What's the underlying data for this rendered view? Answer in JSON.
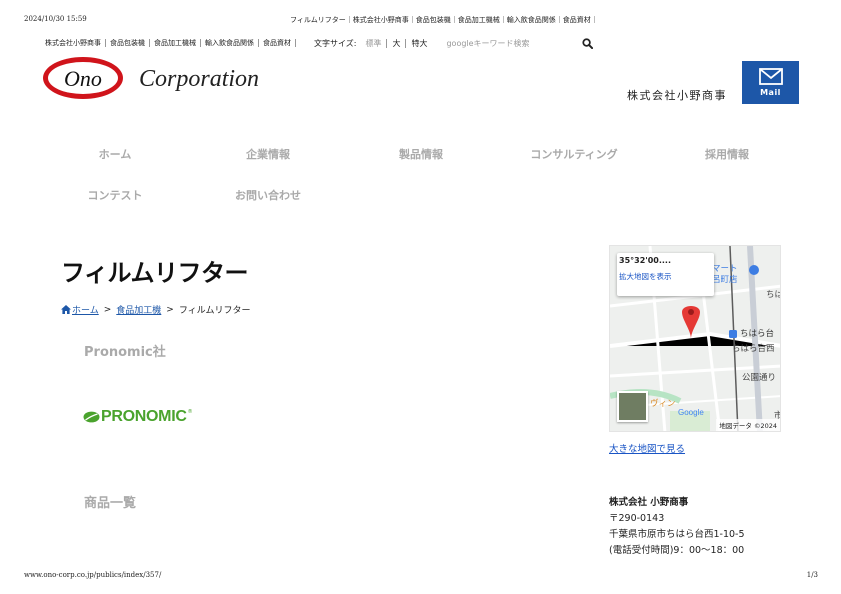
{
  "print": {
    "timestamp": "2024/10/30 15:59",
    "page_title": "フィルムリフター｜株式会社小野商事｜食品包装機｜食品加工機械｜輸入飲食品関係｜食品資材｜",
    "url": "www.ono-corp.co.jp/publics/index/357/",
    "page_number": "1/3"
  },
  "util_links": [
    "株式会社小野商事",
    "食品包装機",
    "食品加工機械",
    "輸入飲食品関係",
    "食品資材"
  ],
  "font_size": {
    "label": "文字サイズ:",
    "options": [
      "標準",
      "大",
      "特大"
    ]
  },
  "search": {
    "placeholder": "googleキーワード検索"
  },
  "logo": {
    "mark": "Ono",
    "word": "Corporation"
  },
  "company_label": "株式会社小野商事",
  "mail": {
    "label": "Mail"
  },
  "nav": [
    "ホーム",
    "企業情報",
    "製品情報",
    "コンサルティング",
    "採用情報",
    "コンテスト",
    "お問い合わせ"
  ],
  "page_title": "フィルムリフター",
  "breadcrumb": {
    "home": "ホーム",
    "category": "食品加工機",
    "current": "フィルムリフター",
    "separator": ">"
  },
  "maker": "Pronomic社",
  "brand": {
    "name": "PRONOMIC",
    "mark": "®"
  },
  "product_list_heading": "商品一覧",
  "map": {
    "coords": "35°32'00....",
    "enlarge_link": "拡大地図を表示",
    "labels": [
      "マート",
      "呂町店",
      "ちは",
      "ちはら台",
      "ちはら台西",
      "公園通り",
      "ヴィン",
      "市",
      "Google"
    ],
    "attribution": "地図データ ©2024"
  },
  "bigmap_link": "大きな地図で見る",
  "address": {
    "company": "株式会社 小野商事",
    "postal": "〒290-0143",
    "street": "千葉県市原市ちはら台西1-10-5",
    "hours": "(電話受付時間)9：00〜18：00"
  },
  "colors": {
    "brand_blue": "#1d57a8",
    "logo_red": "#d0141b",
    "pronomic_green": "#4aa32d",
    "nav_gray": "#aaaaaa",
    "map_pin": "#e53935"
  }
}
